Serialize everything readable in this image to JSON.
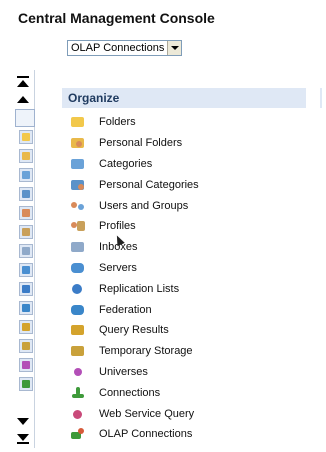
{
  "header": {
    "title": "Central Management Console"
  },
  "selector": {
    "selected": "OLAP Connections"
  },
  "panel": {
    "title": "Organize"
  },
  "organize_items": [
    {
      "label": "Folders",
      "icon": "folder-icon",
      "color": "#f2c84b"
    },
    {
      "label": "Personal Folders",
      "icon": "personal-folder-icon",
      "color": "#e9b94a"
    },
    {
      "label": "Categories",
      "icon": "categories-icon",
      "color": "#6aa2d8"
    },
    {
      "label": "Personal Categories",
      "icon": "personal-categories-icon",
      "color": "#5b92c9"
    },
    {
      "label": "Users and Groups",
      "icon": "users-groups-icon",
      "color": "#d98b5a"
    },
    {
      "label": "Profiles",
      "icon": "profiles-icon",
      "color": "#c9a05a"
    },
    {
      "label": "Inboxes",
      "icon": "inbox-icon",
      "color": "#8fa9c9"
    },
    {
      "label": "Servers",
      "icon": "servers-icon",
      "color": "#4a8fd1"
    },
    {
      "label": "Replication Lists",
      "icon": "replication-icon",
      "color": "#3b7cc7"
    },
    {
      "label": "Federation",
      "icon": "federation-icon",
      "color": "#3a86c9"
    },
    {
      "label": "Query Results",
      "icon": "query-results-icon",
      "color": "#d4a32c"
    },
    {
      "label": "Temporary Storage",
      "icon": "temporary-storage-icon",
      "color": "#c9a13b"
    },
    {
      "label": "Universes",
      "icon": "universes-icon",
      "color": "#b34fb7"
    },
    {
      "label": "Connections",
      "icon": "connections-icon",
      "color": "#3e9a3a"
    },
    {
      "label": "Web Service Query",
      "icon": "web-service-query-icon",
      "color": "#c94a7a"
    },
    {
      "label": "OLAP Connections",
      "icon": "olap-connections-icon",
      "color": "#d65a3a"
    }
  ]
}
